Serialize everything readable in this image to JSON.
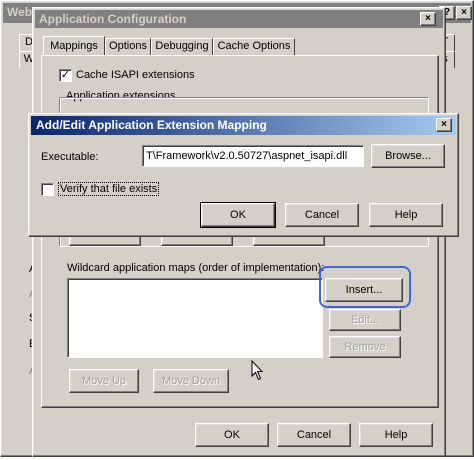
{
  "back_window": {
    "title": "Web",
    "help_button": "?",
    "close_button": "×",
    "left_tab_fragments": [
      "D",
      "W"
    ],
    "right_tab_fragments": [
      "T",
      "s"
    ],
    "left_edge_letters": [
      "A",
      "A",
      "S",
      "E",
      "A"
    ]
  },
  "app_config": {
    "title": "Application Configuration",
    "close_button": "×",
    "tabs": [
      "Mappings",
      "Options",
      "Debugging",
      "Cache Options"
    ],
    "cache_isapi_label": "Cache ISAPI extensions",
    "cache_isapi_checked": true,
    "app_extensions_label": "Application extensions",
    "wildcard_label": "Wildcard application maps (order of implementation):",
    "buttons": {
      "insert": "Insert...",
      "edit": "Edit...",
      "remove": "Remove",
      "move_up": "Move Up",
      "move_down": "Move Down",
      "ok": "OK",
      "cancel": "Cancel",
      "help": "Help"
    }
  },
  "mapping_dialog": {
    "title": "Add/Edit Application Extension Mapping",
    "close_button": "×",
    "executable_label": "Executable:",
    "executable_value": "T\\Framework\\v2.0.50727\\aspnet_isapi.dll",
    "browse_button": "Browse...",
    "verify_label": "Verify that file exists",
    "verify_checked": false,
    "buttons": {
      "ok": "OK",
      "cancel": "Cancel",
      "help": "Help"
    }
  },
  "highlight_color": "#3e67d6"
}
